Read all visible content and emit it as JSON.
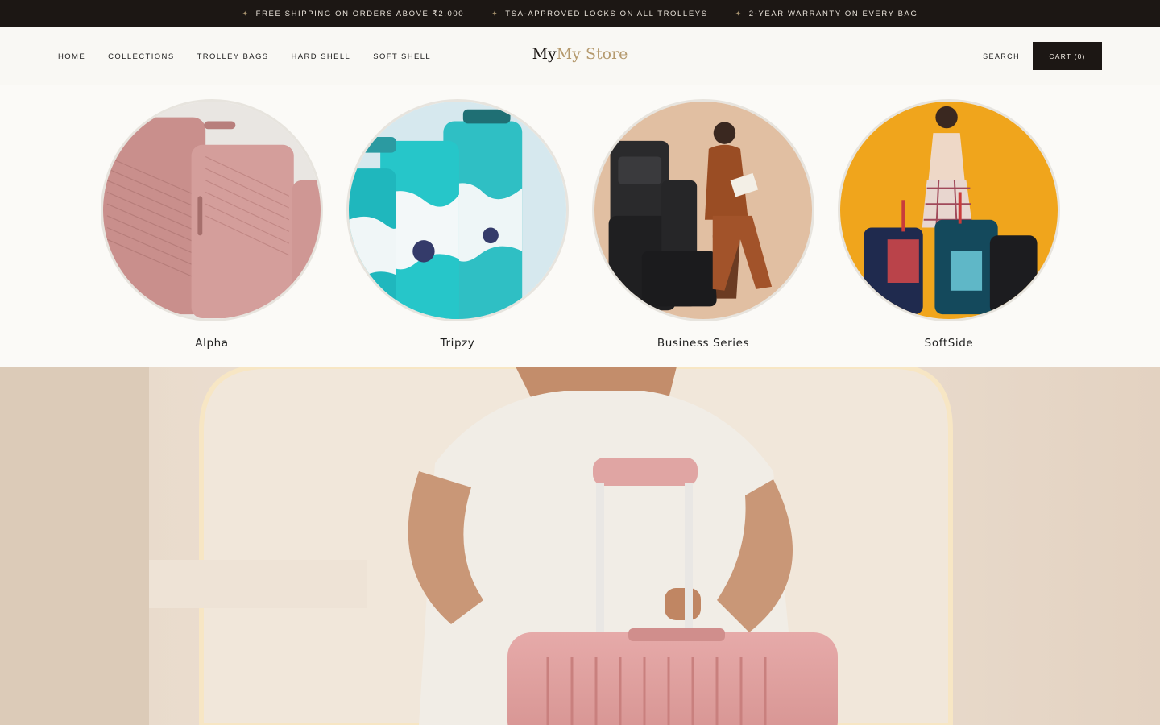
{
  "announcement": {
    "items": [
      "FREE SHIPPING ON ORDERS ABOVE ₹2,000",
      "TSA-APPROVED LOCKS ON ALL TROLLEYS",
      "2-YEAR WARRANTY ON EVERY BAG"
    ],
    "spark": "✦"
  },
  "nav": {
    "items": [
      "HOME",
      "COLLECTIONS",
      "TROLLEY BAGS",
      "HARD SHELL",
      "SOFT SHELL"
    ]
  },
  "logo": {
    "part1": "My",
    "part2": "My Store"
  },
  "header": {
    "search_label": "SEARCH",
    "cart_label": "CART (0)"
  },
  "collections": [
    {
      "label": "Alpha",
      "image": "pink-hardshell-luggage-set"
    },
    {
      "label": "Tripzy",
      "image": "teal-printed-luggage-set"
    },
    {
      "label": "Business Series",
      "image": "woman-seated-black-business-bags"
    },
    {
      "label": "SoftSide",
      "image": "woman-with-softside-trolleys"
    }
  ],
  "hero": {
    "image": "man-with-pink-trolley-bag"
  },
  "colors": {
    "announcement_bg": "#1c1714",
    "accent_gold": "#b59a6e",
    "page_bg": "#fbfaf7"
  }
}
